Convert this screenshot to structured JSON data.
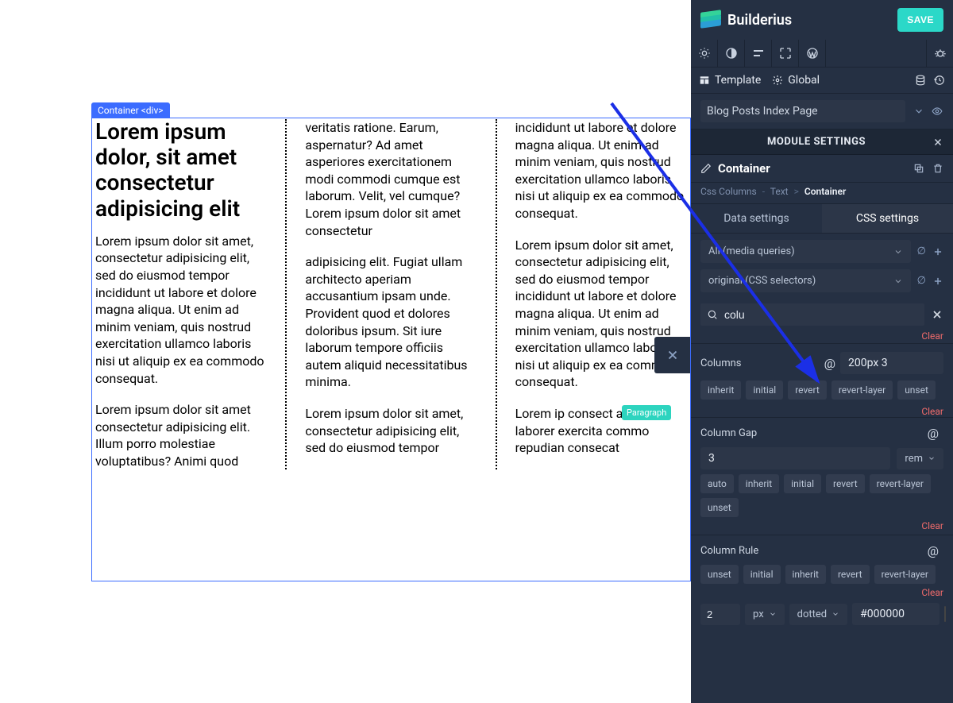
{
  "canvas": {
    "selection_label": "Container <div>",
    "paragraph_tag": "Paragraph",
    "heading": "Lorem ipsum dolor, sit amet consectetur adipisicing elit",
    "p1": "Lorem ipsum dolor sit amet, consectetur adipisicing elit, sed do eiusmod tempor incididunt ut labore et dolore magna aliqua. Ut enim ad minim veniam, quis nostrud exercitation ullamco laboris nisi ut aliquip ex ea commodo consequat.",
    "p2": "Lorem ipsum dolor sit amet consectetur adipisicing elit. Illum porro molestiae voluptatibus? Animi quod veritatis ratione. Earum, aspernatur? Ad amet asperiores exercitationem modi commodi cumque est laborum. Velit, vel cumque? Lorem ipsum dolor sit amet consectetur",
    "p3": "adipisicing elit. Fugiat ullam architecto aperiam accusantium ipsam unde. Provident quod et dolores doloribus ipsum. Sit iure laborum tempore officiis autem aliquid necessitatibus minima.",
    "p4": "Lorem ipsum dolor sit amet, consectetur adipisicing elit, sed do eiusmod tempor incididunt ut labore et dolore magna aliqua. Ut enim ad minim veniam, quis nostrud exercitation ullamco laboris nisi ut aliquip ex ea commodo consequat.",
    "p5": "Lorem ipsum dolor sit amet, consectetur adipisicing elit, sed do eiusmod tempor incididunt ut labore et dolore magna aliqua. Ut enim ad minim veniam, quis nostrud exercitation ullamco laboris nisi ut aliquip ex ea commodo consequat.",
    "p6_partial": "Lorem ip consect aliqua. laborer exercita commo repudian consecat"
  },
  "sidebar": {
    "brand": "Builderius",
    "save_label": "SAVE",
    "mode_template": "Template",
    "mode_global": "Global",
    "page_name": "Blog Posts Index Page",
    "module_settings_title": "MODULE SETTINGS",
    "element_name": "Container",
    "breadcrumb": {
      "a": "Css Columns",
      "b": "Text",
      "c": "Container"
    },
    "tabs": {
      "data": "Data settings",
      "css": "CSS settings"
    },
    "media_query": "All (media queries)",
    "css_selector": "original (CSS selectors)",
    "search_value": "colu",
    "clear_label": "Clear",
    "props": {
      "columns": {
        "label": "Columns",
        "value": "200px 3"
      },
      "column_gap": {
        "label": "Column Gap",
        "value": "3",
        "unit": "rem"
      },
      "column_rule": {
        "label": "Column Rule",
        "width": "2",
        "width_unit": "px",
        "style": "dotted",
        "color": "#000000"
      },
      "keywords_common": [
        "inherit",
        "initial",
        "revert",
        "revert-layer",
        "unset"
      ],
      "keywords_gap": [
        "auto",
        "inherit",
        "initial",
        "revert",
        "revert-layer",
        "unset"
      ],
      "keywords_rule": [
        "unset",
        "initial",
        "inherit",
        "revert",
        "revert-layer"
      ]
    }
  }
}
